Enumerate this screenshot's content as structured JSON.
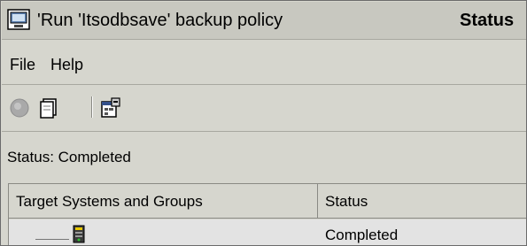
{
  "window": {
    "title": "'Run 'Itsodbsave' backup policy",
    "title_status": "Status"
  },
  "menu": {
    "items": [
      {
        "label": "File"
      },
      {
        "label": "Help"
      }
    ]
  },
  "toolbar": {
    "buttons": [
      {
        "icon": "stop-icon",
        "enabled": false
      },
      {
        "icon": "document-icon",
        "enabled": true
      },
      {
        "icon": "properties-icon",
        "enabled": true
      }
    ]
  },
  "status_line": "Status: Completed",
  "table": {
    "columns": [
      "Target Systems and Groups",
      "Status"
    ],
    "rows": [
      {
        "target": "",
        "status": "Completed",
        "icon": "system-node-icon"
      }
    ]
  }
}
